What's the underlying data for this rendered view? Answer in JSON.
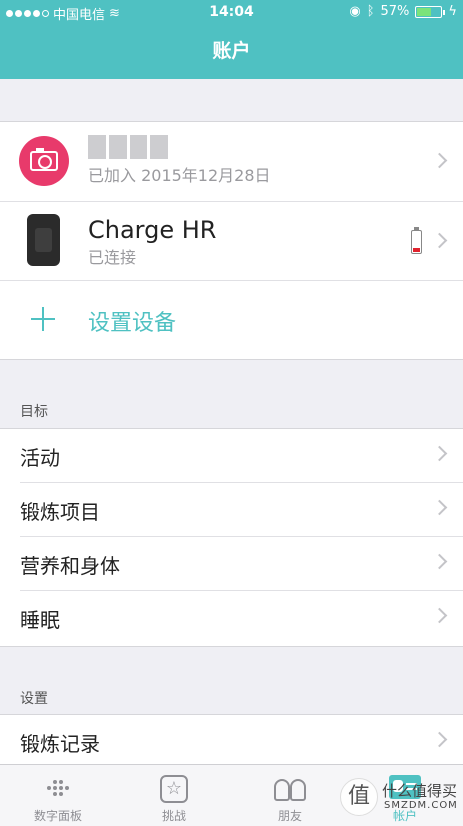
{
  "status_bar": {
    "carrier": "中国电信",
    "time": "14:04",
    "battery": "57%",
    "battery_level": 0.57
  },
  "nav": {
    "title": "账户"
  },
  "profile": {
    "joined": "已加入 2015年12月28日"
  },
  "device": {
    "name": "Charge HR",
    "status": "已连接",
    "battery_color": "#e0232e"
  },
  "setup": {
    "label": "设置设备"
  },
  "goals_section": {
    "title": "目标",
    "items": [
      {
        "label": "活动"
      },
      {
        "label": "锻炼项目"
      },
      {
        "label": "营养和身体"
      },
      {
        "label": "睡眠"
      }
    ]
  },
  "settings_section": {
    "title": "设置",
    "items": [
      {
        "label": "锻炼记录"
      }
    ]
  },
  "tabbar": {
    "tabs": [
      {
        "label": "数字面板",
        "icon": "dashboard-dots-icon"
      },
      {
        "label": "挑战",
        "icon": "star-icon"
      },
      {
        "label": "朋友",
        "icon": "friends-icon"
      },
      {
        "label": "帐户",
        "icon": "account-card-icon"
      }
    ]
  },
  "watermark": {
    "text": "什么值得买",
    "sub": "SMZDM.COM",
    "glyph": "值"
  },
  "colors": {
    "accent": "#4fc1c2",
    "avatar": "#e83a6b"
  }
}
